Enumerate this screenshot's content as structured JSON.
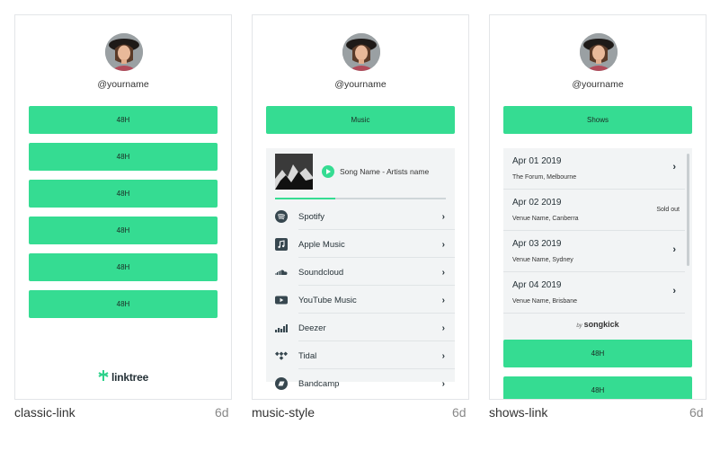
{
  "colors": {
    "accent": "#35dc92",
    "panel": "#f2f4f5",
    "border": "#e3e5e8"
  },
  "cards": [
    {
      "username": "@yourname",
      "buttons": [
        "48H",
        "48H",
        "48H",
        "48H",
        "48H",
        "48H"
      ],
      "logo_text": "linktree",
      "caption": "classic-link",
      "age": "6d"
    },
    {
      "username": "@yourname",
      "header_button": "Music",
      "now_playing": "Song Name - Artists name",
      "progress": 0.35,
      "services": [
        {
          "label": "Spotify",
          "icon": "spotify-icon"
        },
        {
          "label": "Apple Music",
          "icon": "apple-music-icon"
        },
        {
          "label": "Soundcloud",
          "icon": "soundcloud-icon"
        },
        {
          "label": "YouTube Music",
          "icon": "youtube-music-icon"
        },
        {
          "label": "Deezer",
          "icon": "deezer-icon"
        },
        {
          "label": "Tidal",
          "icon": "tidal-icon"
        },
        {
          "label": "Bandcamp",
          "icon": "bandcamp-icon"
        }
      ],
      "caption": "music-style",
      "age": "6d"
    },
    {
      "username": "@yourname",
      "header_button": "Shows",
      "shows": [
        {
          "date": "Apr 01 2019",
          "venue": "The Forum, Melbourne",
          "status": ""
        },
        {
          "date": "Apr 02 2019",
          "venue": "Venue Name, Canberra",
          "status": "Sold out"
        },
        {
          "date": "Apr 03 2019",
          "venue": "Venue Name, Sydney",
          "status": ""
        },
        {
          "date": "Apr 04 2019",
          "venue": "Venue Name, Brisbane",
          "status": ""
        }
      ],
      "powered_by_prefix": "by",
      "powered_by": "songkick",
      "buttons": [
        "48H",
        "48H"
      ],
      "caption": "shows-link",
      "age": "6d"
    }
  ]
}
